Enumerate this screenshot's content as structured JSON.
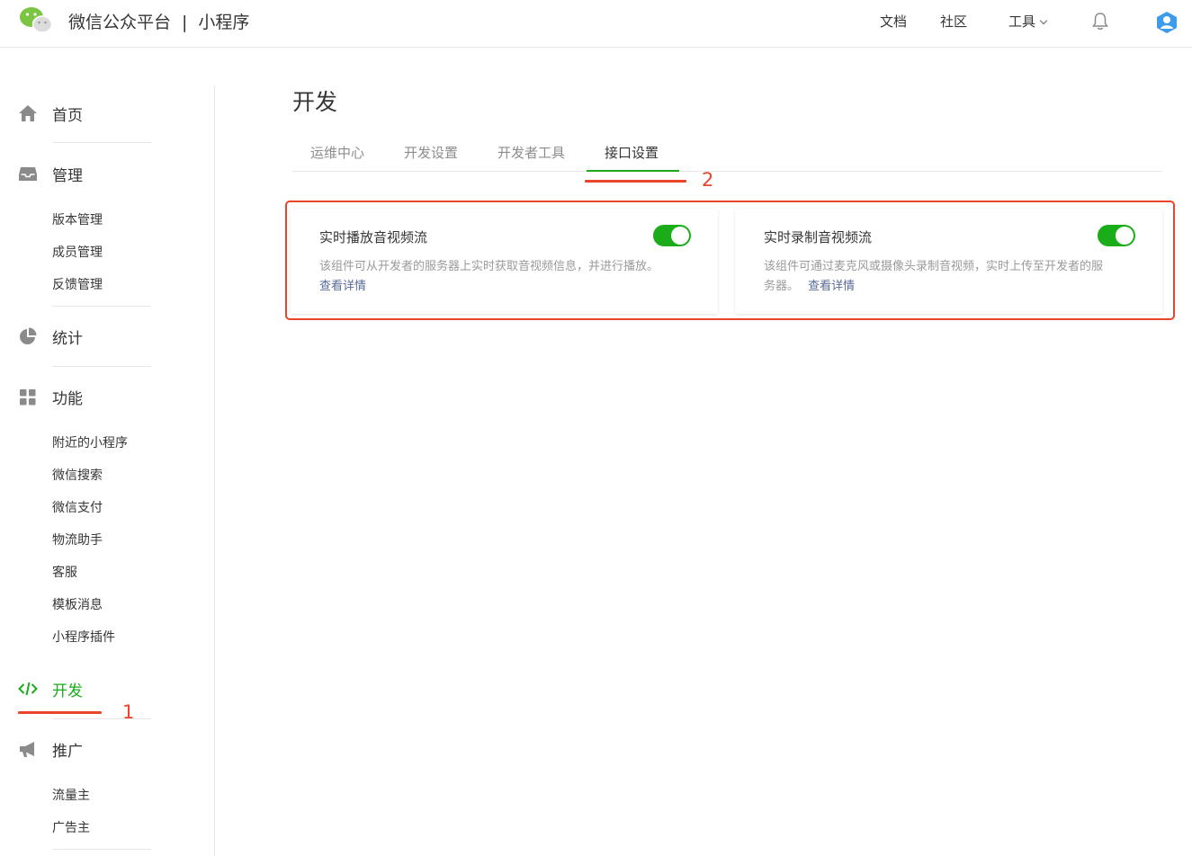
{
  "header": {
    "brand": "微信公众平台",
    "separator": "|",
    "product": "小程序",
    "nav": {
      "docs": "文档",
      "community": "社区",
      "tools": "工具"
    },
    "icons": {
      "logo": "wechat-logo",
      "bell": "bell-icon",
      "avatar": "avatar-icon"
    }
  },
  "sidebar": {
    "home": "首页",
    "manage": {
      "label": "管理",
      "items": [
        "版本管理",
        "成员管理",
        "反馈管理"
      ]
    },
    "stats": "统计",
    "features": {
      "label": "功能",
      "items": [
        "附近的小程序",
        "微信搜索",
        "微信支付",
        "物流助手",
        "客服",
        "模板消息",
        "小程序插件"
      ]
    },
    "develop": "开发",
    "promote": {
      "label": "推广",
      "items": [
        "流量主",
        "广告主"
      ]
    }
  },
  "annotations": {
    "marker1": "1",
    "marker2": "2"
  },
  "main": {
    "title": "开发",
    "tabs": [
      "运维中心",
      "开发设置",
      "开发者工具",
      "接口设置"
    ],
    "active_tab": "接口设置",
    "cards": [
      {
        "title": "实时播放音视频流",
        "desc": "该组件可从开发者的服务器上实时获取音视频信息，并进行播放。",
        "link": "查看详情",
        "enabled": true
      },
      {
        "title": "实时录制音视频流",
        "desc_line1": "该组件可通过麦克风或摄像头录制音视频，实时上传至开发者的服",
        "desc_line2": "务器。",
        "link": "查看详情",
        "enabled": true
      }
    ]
  },
  "colors": {
    "accent": "#1aad19",
    "annotation": "#e8452b",
    "link": "#576b95"
  }
}
